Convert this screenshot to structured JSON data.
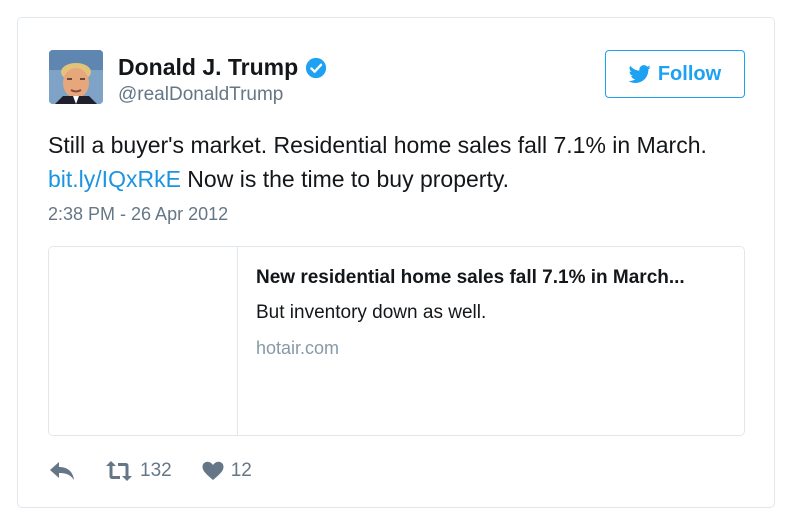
{
  "user": {
    "name": "Donald J. Trump",
    "handle": "@realDonaldTrump",
    "verified": true
  },
  "follow_button": {
    "label": "Follow",
    "icon": "twitter-bird-icon"
  },
  "tweet": {
    "text_before_link": "Still a buyer's market. Residential home sales fall 7.1% in March. ",
    "link": "bit.ly/IQxRkE",
    "text_after_link": " Now is the time to buy property.",
    "timestamp": "2:38 PM - 26 Apr 2012"
  },
  "card": {
    "title": "New residential home sales fall 7.1% in March...",
    "description": "But inventory down as well.",
    "domain": "hotair.com"
  },
  "actions": {
    "reply_icon": "reply-icon",
    "retweet_icon": "retweet-icon",
    "retweet_count": "132",
    "like_icon": "heart-icon",
    "like_count": "12"
  },
  "colors": {
    "accent": "#1da1f2",
    "link": "#1b95e0",
    "secondary_text": "#657786",
    "border": "#e1e8ed"
  }
}
